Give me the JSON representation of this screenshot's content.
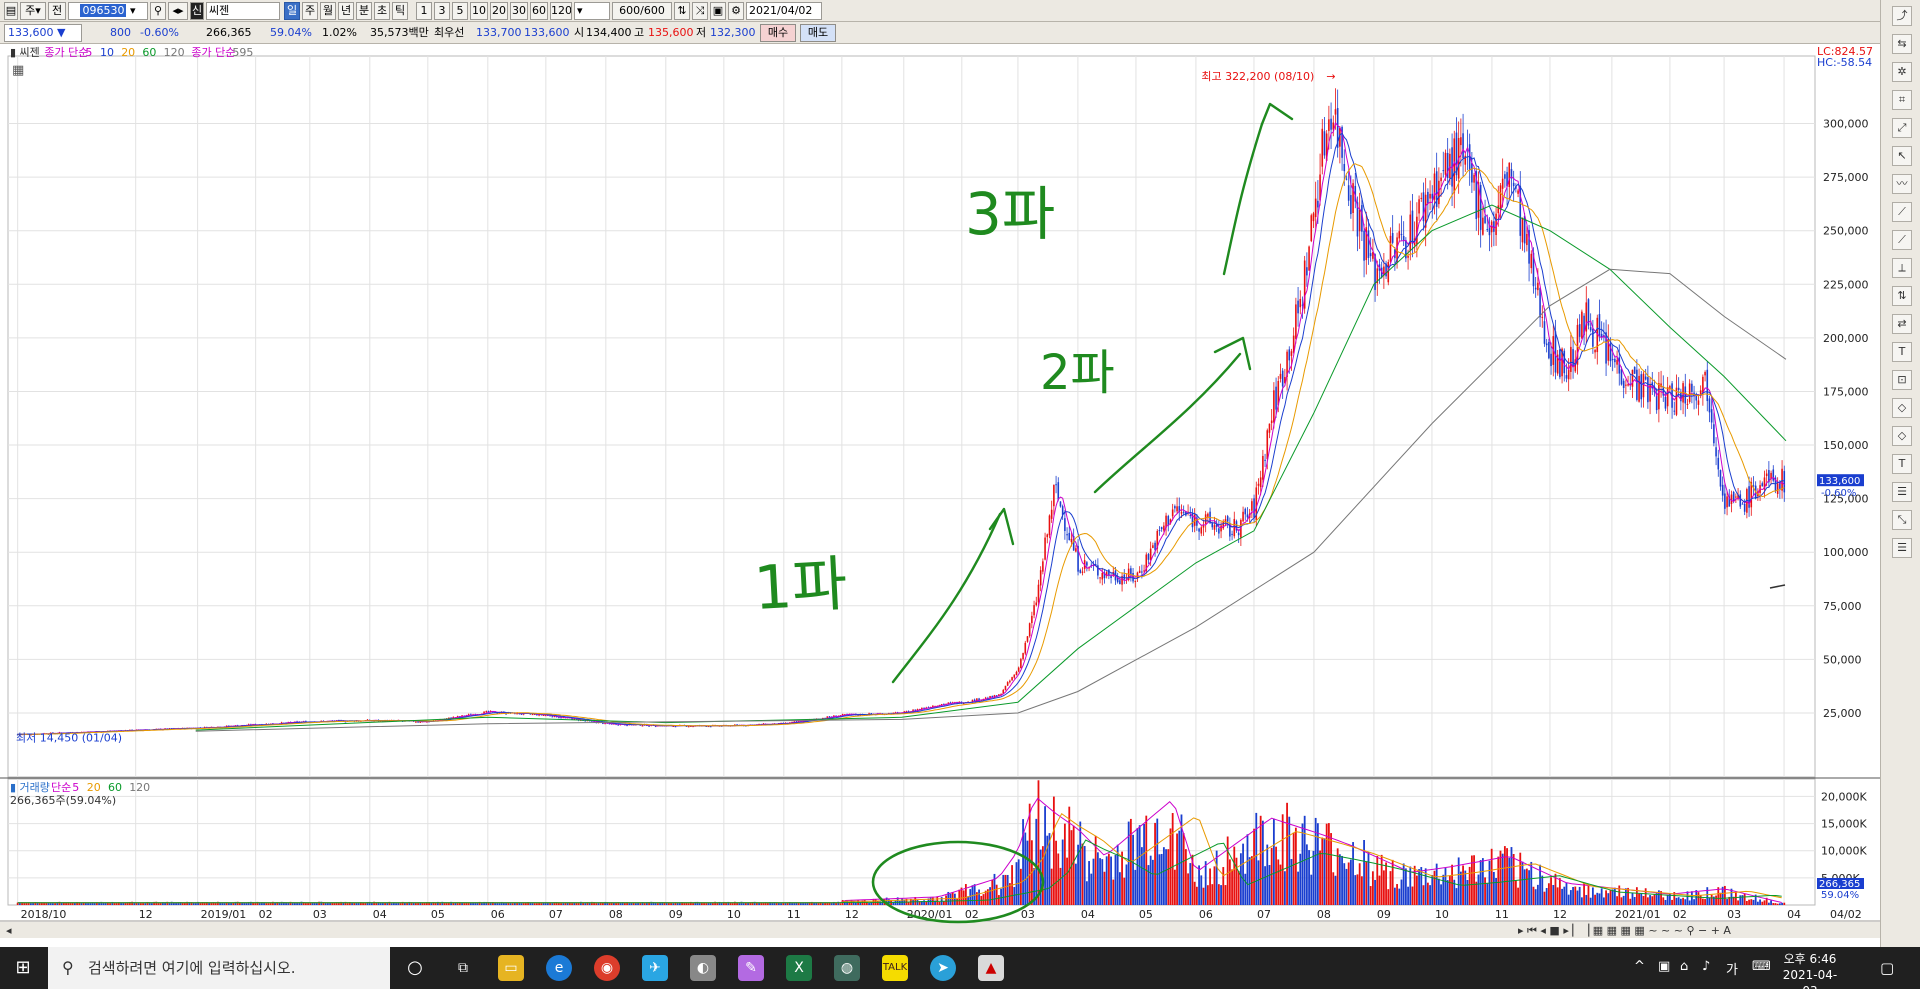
{
  "toolbar": {
    "mode": "주",
    "market_flag": "전",
    "stock_code": "096530",
    "name_flag": "신",
    "stock_name": "씨젠",
    "periods": [
      "일",
      "주",
      "월",
      "년",
      "분",
      "초",
      "틱"
    ],
    "intervals": [
      "1",
      "3",
      "5",
      "10",
      "20",
      "30",
      "60",
      "120"
    ],
    "count": "600/600",
    "date": "2021/04/02"
  },
  "pricebar": {
    "price": "133,600",
    "arrow": "▼",
    "change": "800",
    "change_pct": "-0.60%",
    "volume": "266,365",
    "volume_pct": "59.04%",
    "turnover_pct": "1.02%",
    "amount": "35,573백만",
    "best_label": "최우선",
    "ask": "133,700",
    "bid": "133,600",
    "open_label": "시",
    "open": "134,400",
    "high_label": "고",
    "high": "135,600",
    "low_label": "저",
    "low": "132,300",
    "buy_label": "매수",
    "sell_label": "매도"
  },
  "price_legend": {
    "name": "씨젠",
    "ma_label": "종가 단순",
    "ma_periods": [
      "5",
      "10",
      "20",
      "60",
      "120"
    ],
    "ma2_label": "종가 단순",
    "ma2_period": "595"
  },
  "price_header": {
    "lc": "LC:824.57",
    "hc": "HC:-58.54"
  },
  "volume_legend": {
    "name": "거래량",
    "ma_label": "단순",
    "ma_periods": [
      "5",
      "20",
      "60",
      "120"
    ],
    "current": "266,365주(59.04%)"
  },
  "annotations": {
    "high": "최고 322,200 (08/10)",
    "low": "최저 14,450 (01/04)",
    "wave1": "1파",
    "wave2": "2파",
    "wave3": "3파"
  },
  "current_price_tag": {
    "price": "133,600",
    "pct": "-0.60%"
  },
  "colors": {
    "up": "#e81010",
    "down": "#1a3ecf",
    "ma5": "#cc00cc",
    "ma10": "#1a3ecf",
    "ma20": "#e89a00",
    "ma60": "#0a9a2a",
    "ma120": "#777777",
    "handwriting": "#1f8a1f"
  },
  "chart_data": [
    {
      "type": "candlestick",
      "title": "씨젠 (096530) 일봉",
      "x_ticks": [
        "2018/10",
        "12",
        "2019/01",
        "02",
        "03",
        "04",
        "05",
        "06",
        "07",
        "08",
        "09",
        "10",
        "11",
        "12",
        "2020/01",
        "02",
        "03",
        "04",
        "05",
        "06",
        "07",
        "08",
        "09",
        "10",
        "11",
        "12",
        "2021/01",
        "02",
        "03",
        "04",
        "04/02"
      ],
      "y_ticks": [
        "25,000",
        "50,000",
        "75,000",
        "100,000",
        "125,000",
        "150,000",
        "175,000",
        "200,000",
        "225,000",
        "250,000",
        "275,000",
        "300,000"
      ],
      "ylim": [
        0,
        330000
      ],
      "close_path": [
        [
          "2018/10/01",
          15000
        ],
        [
          "2018/12/01",
          17000
        ],
        [
          "2019/01/01",
          18000
        ],
        [
          "2019/03/01",
          21000
        ],
        [
          "2019/04/01",
          21500
        ],
        [
          "2019/05/01",
          21000
        ],
        [
          "2019/06/01",
          25500
        ],
        [
          "2019/07/01",
          24000
        ],
        [
          "2019/08/01",
          20000
        ],
        [
          "2019/09/01",
          19000
        ],
        [
          "2019/10/01",
          19000
        ],
        [
          "2019/11/01",
          20000
        ],
        [
          "2019/12/01",
          24000
        ],
        [
          "2020/01/01",
          25000
        ],
        [
          "2020/01/20",
          29000
        ],
        [
          "2020/02/01",
          30000
        ],
        [
          "2020/02/20",
          33000
        ],
        [
          "2020/03/01",
          45000
        ],
        [
          "2020/03/10",
          75000
        ],
        [
          "2020/03/20",
          130000
        ],
        [
          "2020/04/01",
          95000
        ],
        [
          "2020/04/15",
          90000
        ],
        [
          "2020/05/01",
          88000
        ],
        [
          "2020/05/20",
          120000
        ],
        [
          "2020/06/01",
          115000
        ],
        [
          "2020/06/20",
          110000
        ],
        [
          "2020/07/01",
          120000
        ],
        [
          "2020/07/10",
          165000
        ],
        [
          "2020/07/25",
          215000
        ],
        [
          "2020/08/05",
          285000
        ],
        [
          "2020/08/10",
          310000
        ],
        [
          "2020/08/20",
          270000
        ],
        [
          "2020/09/01",
          230000
        ],
        [
          "2020/09/20",
          250000
        ],
        [
          "2020/10/01",
          270000
        ],
        [
          "2020/10/15",
          285000
        ],
        [
          "2020/11/01",
          250000
        ],
        [
          "2020/11/10",
          280000
        ],
        [
          "2020/11/20",
          235000
        ],
        [
          "2020/12/01",
          195000
        ],
        [
          "2020/12/10",
          185000
        ],
        [
          "2020/12/20",
          210000
        ],
        [
          "2021/01/01",
          190000
        ],
        [
          "2021/01/20",
          175000
        ],
        [
          "2021/02/01",
          172000
        ],
        [
          "2021/02/20",
          180000
        ],
        [
          "2021/03/01",
          125000
        ],
        [
          "2021/03/10",
          122000
        ],
        [
          "2021/03/20",
          132000
        ],
        [
          "2021/04/02",
          133600
        ]
      ],
      "moving_averages": [
        {
          "name": "60",
          "values": [
            [
              "2019/01/01",
              17000
            ],
            [
              "2019/06/01",
              23000
            ],
            [
              "2019/09/01",
              20500
            ],
            [
              "2020/01/01",
              23000
            ],
            [
              "2020/03/01",
              30000
            ],
            [
              "2020/04/01",
              55000
            ],
            [
              "2020/06/01",
              95000
            ],
            [
              "2020/07/01",
              110000
            ],
            [
              "2020/08/01",
              165000
            ],
            [
              "2020/09/01",
              225000
            ],
            [
              "2020/10/01",
              250000
            ],
            [
              "2020/11/01",
              262000
            ],
            [
              "2020/12/01",
              250000
            ],
            [
              "2021/01/01",
              232000
            ],
            [
              "2021/02/01",
              205000
            ],
            [
              "2021/03/01",
              182000
            ],
            [
              "2021/04/02",
              152000
            ]
          ]
        },
        {
          "name": "120",
          "values": [
            [
              "2019/01/01",
              16500
            ],
            [
              "2019/06/01",
              20000
            ],
            [
              "2020/01/01",
              22000
            ],
            [
              "2020/03/01",
              25000
            ],
            [
              "2020/04/01",
              35000
            ],
            [
              "2020/06/01",
              65000
            ],
            [
              "2020/08/01",
              100000
            ],
            [
              "2020/10/01",
              160000
            ],
            [
              "2020/12/01",
              215000
            ],
            [
              "2021/01/01",
              232000
            ],
            [
              "2021/02/01",
              230000
            ],
            [
              "2021/03/01",
              210000
            ],
            [
              "2021/04/02",
              190000
            ]
          ]
        }
      ],
      "annotations": [
        "최고 322,200 (08/10)",
        "최저 14,450 (01/04)"
      ]
    },
    {
      "type": "bar",
      "title": "거래량",
      "y_ticks": [
        "5,000K",
        "10,000K",
        "15,000K",
        "20,000K"
      ],
      "ylim": [
        0,
        21000000
      ],
      "series": [
        {
          "name": "거래량",
          "values": [
            [
              "2019/12/01",
              800000
            ],
            [
              "2020/01/20",
              1500000
            ],
            [
              "2020/02/20",
              5000000
            ],
            [
              "2020/03/01",
              10000000
            ],
            [
              "2020/03/10",
              20000000
            ],
            [
              "2020/03/20",
              17000000
            ],
            [
              "2020/04/01",
              14000000
            ],
            [
              "2020/04/15",
              9000000
            ],
            [
              "2020/05/20",
              19500000
            ],
            [
              "2020/06/01",
              6000000
            ],
            [
              "2020/07/10",
              16000000
            ],
            [
              "2020/08/05",
              13000000
            ],
            [
              "2020/08/20",
              11000000
            ],
            [
              "2020/09/20",
              6000000
            ],
            [
              "2020/10/10",
              7000000
            ],
            [
              "2020/11/10",
              9000000
            ],
            [
              "2020/12/10",
              4000000
            ],
            [
              "2021/02/01",
              2000000
            ],
            [
              "2021/03/01",
              3000000
            ],
            [
              "2021/04/02",
              266365
            ]
          ]
        }
      ]
    }
  ]
}
